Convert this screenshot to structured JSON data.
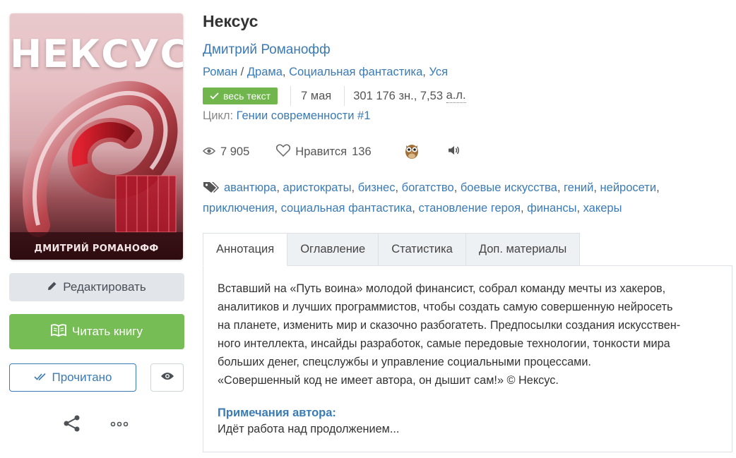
{
  "book": {
    "title": "Нексус",
    "author": "Дмитрий Романофф",
    "cover": {
      "title": "НЕКСУС",
      "author": "ДМИТРИЙ РОМАНОФФ"
    },
    "genres": [
      {
        "label": "Роман",
        "sep": " / "
      },
      {
        "label": "Драма",
        "sep": ", "
      },
      {
        "label": "Социальная фантастика",
        "sep": ", "
      },
      {
        "label": "Уся",
        "sep": ""
      }
    ],
    "status_badge": "весь текст",
    "date": "7 мая",
    "size_prefix": "301 176 зн., 7,53 ",
    "size_unit": "а.л.",
    "cycle_label": "Цикл:",
    "cycle_link": "Гении современности #1"
  },
  "stats": {
    "views": "7 905",
    "likes_label": "Нравится",
    "likes_count": "136"
  },
  "tags": [
    {
      "label": "авантюра",
      "sep": ", "
    },
    {
      "label": "аристократы",
      "sep": ", "
    },
    {
      "label": "бизнес",
      "sep": ", "
    },
    {
      "label": "богатство",
      "sep": ", "
    },
    {
      "label": "боевые искусства",
      "sep": ", "
    },
    {
      "label": "гений",
      "sep": ", "
    },
    {
      "label": "нейросети",
      "sep": ", "
    },
    {
      "label": "приключения",
      "sep": ", "
    },
    {
      "label": "социальная фантастика",
      "sep": ", "
    },
    {
      "label": "становление героя",
      "sep": ", "
    },
    {
      "label": "финансы",
      "sep": ", "
    },
    {
      "label": "хакеры",
      "sep": ""
    }
  ],
  "tabs": [
    "Аннотация",
    "Оглавление",
    "Статистика",
    "Доп. материалы"
  ],
  "annotation": {
    "text": "Вставший на «Путь воина» молодой финансист, собрал команду мечты из хакеров,\nаналитиков и лучших программистов, чтобы создать самую совершенную нейросеть\nна планете, изменить мир и сказочно разбогатеть. Предпосылки создания искусствен-\nного интеллекта, инсайды разработок, самые передовые технологии, тонкости мира\nбольших денег, спецслужбы и управление социальными процессами.\n«Совершенный код не имеет автора, он дышит сам!» © Нексус.",
    "notes_title": "Примечания автора:",
    "notes_text": "Идёт работа над продолжением..."
  },
  "buttons": {
    "edit": "Редактировать",
    "read": "Читать книгу",
    "done": "Прочитано"
  },
  "icons": {
    "badge": "check-icon",
    "edit": "pencil-icon",
    "read": "open-book-icon",
    "done": "double-check-icon",
    "eye": "eye-icon",
    "share": "share-icon",
    "more": "more-icon",
    "views": "eye-icon",
    "likes": "heart-icon",
    "owl": "owl-icon",
    "speaker": "speaker-icon",
    "tags": "tag-icon"
  },
  "colors": {
    "link": "#3a7ab5",
    "green": "#76bd55",
    "badge_green": "#70b64d",
    "edit_bg": "#e2e6eb"
  }
}
